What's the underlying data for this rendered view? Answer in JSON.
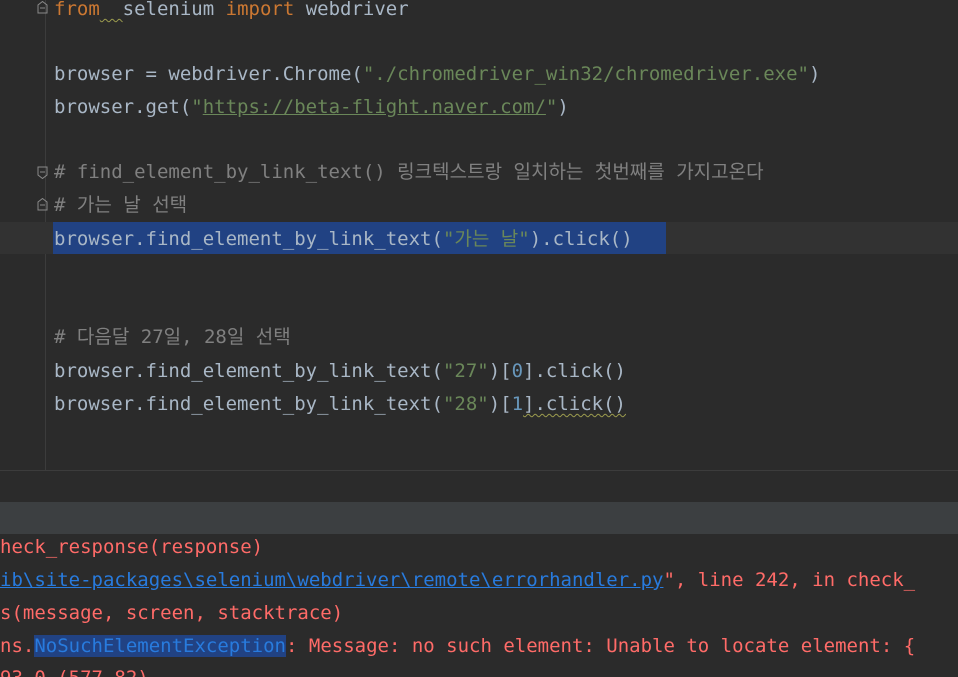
{
  "editor": {
    "l1": {
      "from": "from",
      "mod": "selenium",
      "imp": "import",
      "name": "webdriver"
    },
    "l3": {
      "pre": "browser = webdriver.Chrome(",
      "str": "\"./chromedriver_win32/chromedriver.exe\"",
      "post": ")"
    },
    "l4": {
      "pre": "browser.get(",
      "q1": "\"",
      "url": "https://beta-flight.naver.com/",
      "q2": "\"",
      "post": ")"
    },
    "l6": "# find_element_by_link_text() 링크텍스트랑 일치하는 첫번째를 가지고온다",
    "l7": "# 가는 날 선택",
    "l8": {
      "pre": "browser.find_element_by_link_text(",
      "str": "\"가는 날\"",
      "post": ").click()"
    },
    "l11": "# 다음달 27일, 28일 선택",
    "l12": {
      "pre": "browser.find_element_by_link_text(",
      "str": "\"27\"",
      "mid": ")[",
      "idx": "0",
      "post": "].click()"
    },
    "l13": {
      "pre": "browser.find_element_by_link_text(",
      "str": "\"28\"",
      "mid": ")[",
      "idx": "1",
      "post": "].click()"
    }
  },
  "console": {
    "c1": "heck_response(response)",
    "c2": {
      "link": "ib\\site-packages\\selenium\\webdriver\\remote\\errorhandler.py",
      "post": "\", line 242, in check_"
    },
    "c3": "s(message, screen, stacktrace)",
    "c4": {
      "pre": "ns.",
      "exc": "NoSuchElementException",
      "post": ": Message: no such element: Unable to locate element: {"
    },
    "c5": "93.0 (577.82)"
  },
  "colors": {
    "keyword": "#cc7832",
    "string": "#6a8759",
    "comment": "#808080",
    "number": "#6897bb",
    "text": "#a9b7c6",
    "error": "#ff6b68",
    "link": "#287bde",
    "selection": "#214283",
    "background": "#2b2b2b"
  }
}
